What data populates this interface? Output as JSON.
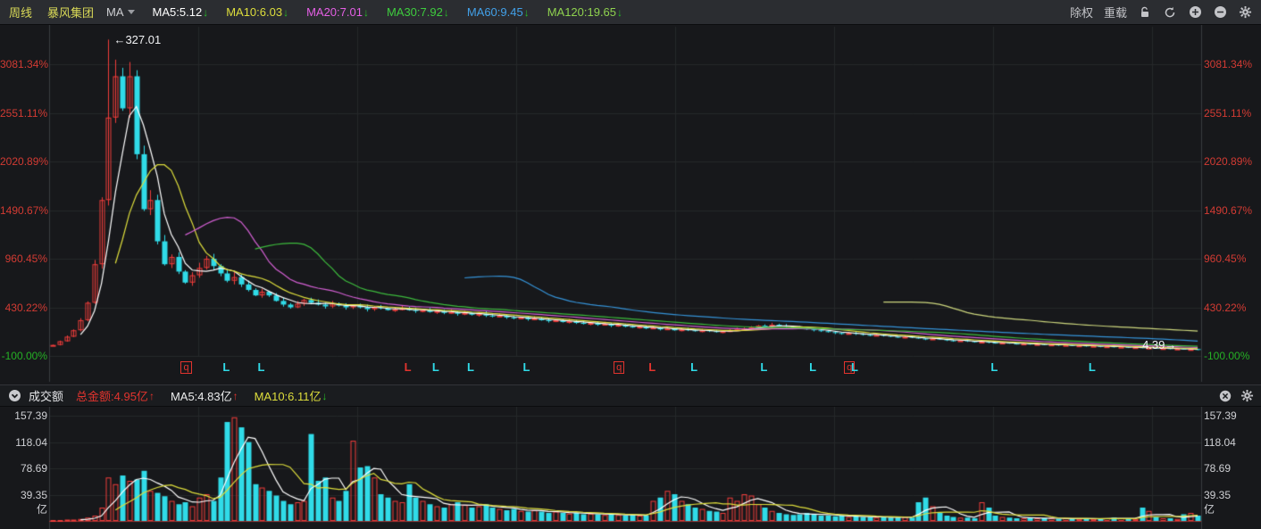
{
  "toolbar": {
    "period": "周线",
    "stock_name": "暴风集团",
    "ma_selector": "MA",
    "ma_items": [
      {
        "label": "MA5:5.12",
        "color": "#ffffff",
        "arrow": "down"
      },
      {
        "label": "MA10:6.03",
        "color": "#dede3c",
        "arrow": "down"
      },
      {
        "label": "MA20:7.01",
        "color": "#e55fe5",
        "arrow": "down"
      },
      {
        "label": "MA30:7.92",
        "color": "#3ecc3e",
        "arrow": "down"
      },
      {
        "label": "MA60:9.45",
        "color": "#42a0e8",
        "arrow": "down"
      },
      {
        "label": "MA120:19.65",
        "color": "#8fd24f",
        "arrow": "down"
      }
    ],
    "actions": {
      "exright": "除权",
      "reload": "重载"
    }
  },
  "volume_header": {
    "title": "成交额",
    "items": [
      {
        "label": "总金额:4.95亿",
        "color": "#e3342e",
        "arrow": "up"
      },
      {
        "label": "MA5:4.83亿",
        "color": "#eceded",
        "arrow": "up"
      },
      {
        "label": "MA10:6.11亿",
        "color": "#dede3c",
        "arrow": "down"
      }
    ]
  },
  "annotations": {
    "peak": "←327.01",
    "last": "4.39→"
  },
  "axes": {
    "main": [
      "3081.34%",
      "2551.11%",
      "2020.89%",
      "1490.67%",
      "960.45%",
      "430.22%",
      "-100.00%"
    ],
    "main_negative_color": "#25b025",
    "main_color": "#d23b33",
    "volume": [
      "157.39",
      "118.04",
      "78.69",
      "39.35",
      "亿"
    ],
    "volume_color": "#cfd0d4"
  },
  "markers": [
    {
      "i": 19,
      "t": "q",
      "c": "red"
    },
    {
      "i": 25,
      "t": "L",
      "c": "cyan"
    },
    {
      "i": 30,
      "t": "L",
      "c": "cyan"
    },
    {
      "i": 51,
      "t": "L",
      "c": "red"
    },
    {
      "i": 55,
      "t": "L",
      "c": "cyan"
    },
    {
      "i": 60,
      "t": "L",
      "c": "cyan"
    },
    {
      "i": 68,
      "t": "L",
      "c": "cyan"
    },
    {
      "i": 81,
      "t": "q",
      "c": "red"
    },
    {
      "i": 86,
      "t": "L",
      "c": "red"
    },
    {
      "i": 92,
      "t": "L",
      "c": "cyan"
    },
    {
      "i": 102,
      "t": "L",
      "c": "cyan"
    },
    {
      "i": 109,
      "t": "L",
      "c": "cyan"
    },
    {
      "i": 114,
      "t": "q",
      "c": "red"
    },
    {
      "i": 115,
      "t": "L",
      "c": "cyan"
    },
    {
      "i": 135,
      "t": "L",
      "c": "cyan"
    },
    {
      "i": 149,
      "t": "L",
      "c": "cyan"
    }
  ],
  "chart_data": {
    "type": "candlestick+volume",
    "title": "暴风集团 周线",
    "y_axis_percent": {
      "min": -100,
      "max": 3480,
      "gridlines": [
        3081.34,
        2551.11,
        2020.89,
        1490.67,
        960.45,
        430.22,
        -100
      ]
    },
    "peak": {
      "index": 8,
      "high": 3350,
      "price_label": "327.01"
    },
    "last_price_label": "4.39",
    "up_color": "#f23d3b",
    "down_color": "#30dbe8",
    "closes": [
      20,
      60,
      110,
      180,
      290,
      480,
      900,
      1600,
      2500,
      2950,
      2600,
      2950,
      2100,
      1500,
      1600,
      1150,
      900,
      980,
      820,
      700,
      780,
      860,
      960,
      880,
      800,
      720,
      760,
      680,
      620,
      560,
      600,
      560,
      500,
      460,
      430,
      470,
      510,
      480,
      460,
      440,
      470,
      450,
      430,
      450,
      430,
      410,
      430,
      420,
      400,
      410,
      420,
      400,
      390,
      400,
      380,
      390,
      370,
      380,
      360,
      370,
      350,
      360,
      340,
      330,
      340,
      320,
      310,
      320,
      300,
      310,
      290,
      280,
      290,
      270,
      280,
      260,
      250,
      260,
      240,
      250,
      230,
      240,
      220,
      210,
      220,
      200,
      210,
      190,
      200,
      180,
      190,
      180,
      170,
      180,
      170,
      160,
      170,
      180,
      190,
      200,
      210,
      230,
      220,
      240,
      230,
      220,
      210,
      200,
      190,
      180,
      170,
      160,
      150,
      140,
      150,
      140,
      130,
      120,
      130,
      120,
      110,
      100,
      110,
      100,
      90,
      80,
      90,
      80,
      70,
      60,
      70,
      60,
      50,
      55,
      45,
      40,
      45,
      35,
      30,
      35,
      25,
      30,
      20,
      25,
      15,
      20,
      10,
      15,
      5,
      10,
      0,
      5,
      -5,
      0,
      -10,
      -5,
      -15,
      -10,
      -20,
      -15,
      -25,
      -20,
      -30,
      -25,
      -35
    ],
    "volumes": [
      1,
      1,
      2,
      2,
      3,
      5,
      8,
      20,
      65,
      55,
      68,
      60,
      62,
      75,
      45,
      42,
      37,
      30,
      25,
      28,
      22,
      35,
      40,
      30,
      65,
      148,
      155,
      140,
      118,
      55,
      50,
      45,
      38,
      30,
      25,
      28,
      30,
      130,
      60,
      65,
      35,
      30,
      45,
      120,
      80,
      82,
      65,
      40,
      35,
      30,
      28,
      55,
      35,
      30,
      25,
      22,
      20,
      25,
      28,
      24,
      20,
      22,
      25,
      20,
      18,
      16,
      18,
      15,
      14,
      16,
      14,
      12,
      14,
      12,
      11,
      12,
      10,
      11,
      10,
      9,
      10,
      9,
      8,
      9,
      8,
      8,
      30,
      35,
      45,
      40,
      30,
      25,
      20,
      18,
      15,
      14,
      12,
      35,
      30,
      40,
      38,
      25,
      20,
      15,
      12,
      10,
      9,
      10,
      12,
      10,
      8,
      8,
      7,
      8,
      6,
      7,
      6,
      6,
      5,
      6,
      5,
      5,
      6,
      5,
      28,
      35,
      22,
      12,
      8,
      6,
      5,
      5,
      4,
      28,
      20,
      8,
      6,
      5,
      4,
      4,
      5,
      4,
      4,
      4,
      3,
      4,
      3,
      3,
      4,
      3,
      3,
      4,
      5,
      4,
      3,
      3,
      20,
      15,
      6,
      4,
      4,
      3,
      10,
      12,
      8
    ],
    "ma_windows": [
      5,
      10,
      20,
      30,
      60,
      120
    ],
    "ma_colors": [
      "#ffffff",
      "#dede3c",
      "#d35fd3",
      "#3dbb3d",
      "#3593d8",
      "#cdd77e"
    ],
    "vol_ma_windows": [
      5,
      10
    ],
    "vol_ma_colors": [
      "#ffffff",
      "#dede3c"
    ],
    "vol_gridlines": [
      157.39,
      118.04,
      78.69,
      39.35
    ]
  }
}
